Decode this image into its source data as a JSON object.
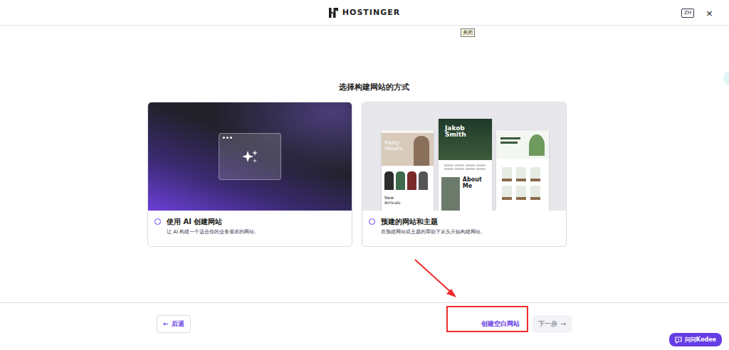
{
  "header": {
    "logo": "HOSTINGER",
    "language": "ZH",
    "close": "×"
  },
  "tooltip": "关闭",
  "title": "选择构建网站的方式",
  "options": [
    {
      "kind": "ai",
      "title": "使用 AI 创建网站",
      "description": "让 AI 构建一个适合你的业务需求的网站。",
      "selected": false
    },
    {
      "kind": "templates",
      "title": "预建的网站和主题",
      "description": "在预建网站或主题的帮助下从头开始构建网站。",
      "selected": false,
      "preview_texts": [
        "Party Wears",
        "New Arrivals",
        "Jakob Smith",
        "About Me"
      ]
    }
  ],
  "footer": {
    "back": {
      "icon": "←",
      "label": "后退"
    },
    "blank": "创建空白网站",
    "next": {
      "label": "下一步",
      "icon": "→",
      "disabled": true
    }
  },
  "chat": {
    "label": "问问Kodee"
  }
}
